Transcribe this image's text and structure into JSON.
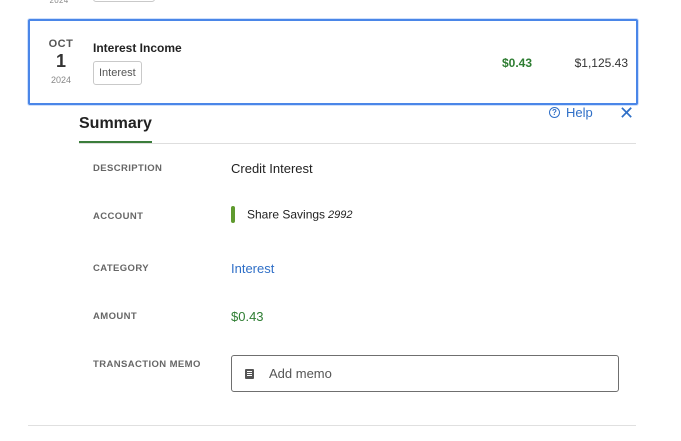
{
  "previous_row": {
    "year": "2024"
  },
  "transaction": {
    "date": {
      "month": "OCT",
      "day": "1",
      "year": "2024"
    },
    "title": "Interest Income",
    "tag": "Interest",
    "amount": "$0.43",
    "balance": "$1,125.43"
  },
  "summary": {
    "tab_label": "Summary",
    "help_label": "Help",
    "help_icon": "question-circle-icon",
    "close_icon": "close-icon",
    "fields": {
      "description": {
        "label": "DESCRIPTION",
        "value": "Credit Interest"
      },
      "account": {
        "label": "ACCOUNT",
        "name": "Share Savings",
        "number": "2992",
        "color": "#5f9a2e"
      },
      "category": {
        "label": "CATEGORY",
        "value": "Interest"
      },
      "amount": {
        "label": "AMOUNT",
        "value": "$0.43"
      },
      "memo": {
        "label": "TRANSACTION MEMO",
        "placeholder": "Add memo",
        "value": ""
      }
    }
  },
  "colors": {
    "accent": "#2f6fc7",
    "positive": "#2e7d32",
    "selected_border": "#4a86e8"
  }
}
